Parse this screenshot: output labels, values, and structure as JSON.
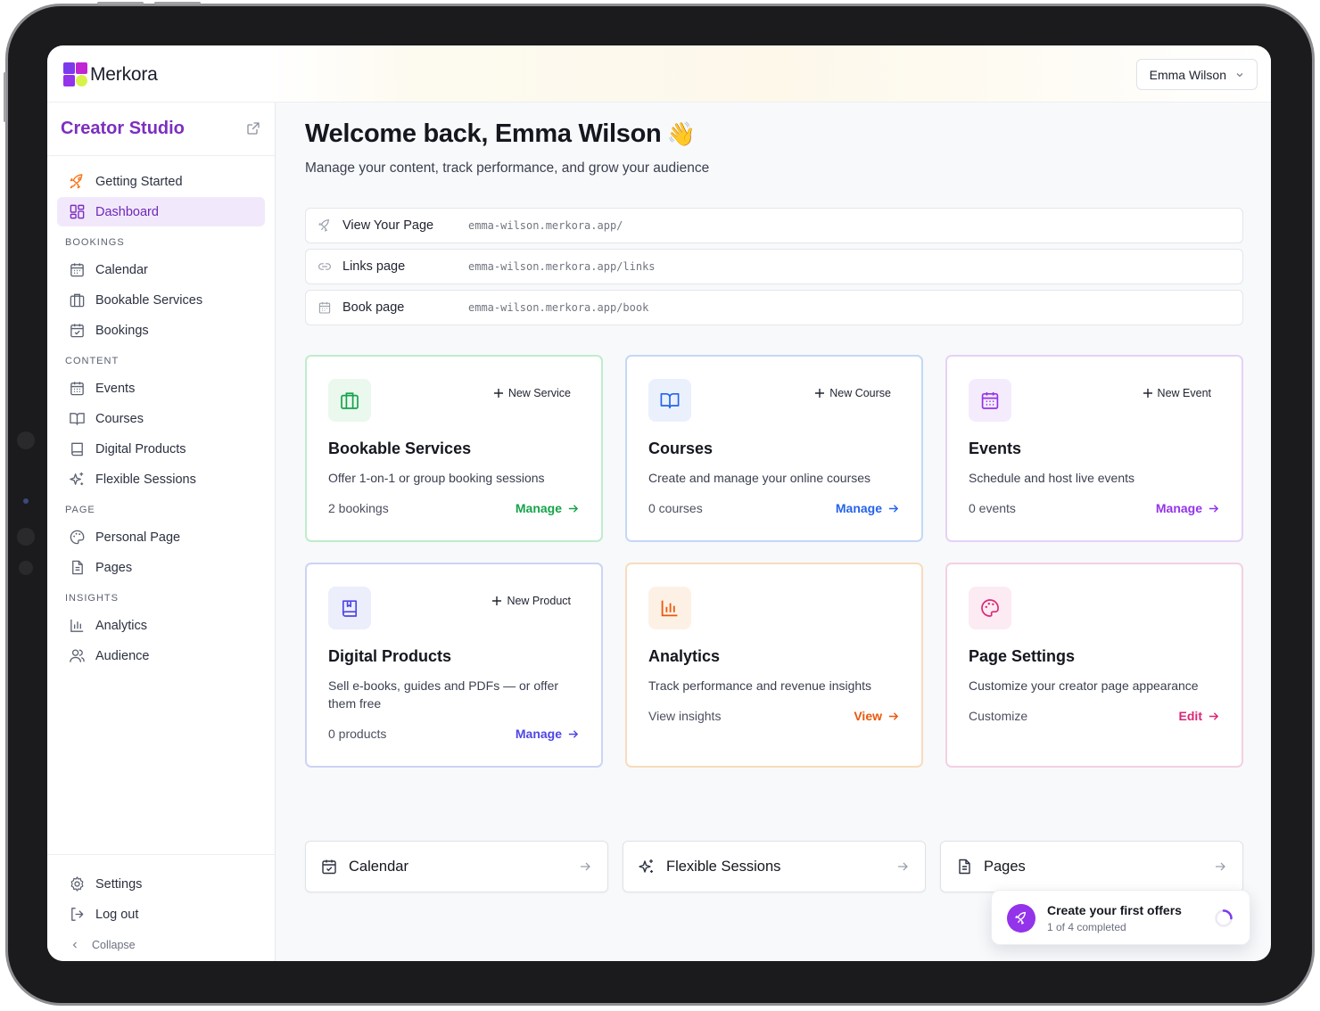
{
  "app": {
    "brand": "Merkora",
    "user_name": "Emma Wilson"
  },
  "sidebar": {
    "title": "Creator Studio",
    "top_items": [
      {
        "label": "Getting Started",
        "icon": "rocket-icon"
      },
      {
        "label": "Dashboard",
        "icon": "dashboard-icon",
        "active": true
      }
    ],
    "sections": [
      {
        "title": "BOOKINGS",
        "items": [
          {
            "label": "Calendar",
            "icon": "calendar-icon"
          },
          {
            "label": "Bookable Services",
            "icon": "briefcase-icon"
          },
          {
            "label": "Bookings",
            "icon": "calendar-check-icon"
          }
        ]
      },
      {
        "title": "CONTENT",
        "items": [
          {
            "label": "Events",
            "icon": "calendar-grid-icon"
          },
          {
            "label": "Courses",
            "icon": "book-open-icon"
          },
          {
            "label": "Digital Products",
            "icon": "book-icon"
          },
          {
            "label": "Flexible Sessions",
            "icon": "sparkles-icon"
          }
        ]
      },
      {
        "title": "PAGE",
        "items": [
          {
            "label": "Personal Page",
            "icon": "palette-icon"
          },
          {
            "label": "Pages",
            "icon": "file-text-icon"
          }
        ]
      },
      {
        "title": "INSIGHTS",
        "items": [
          {
            "label": "Analytics",
            "icon": "bar-chart-icon"
          },
          {
            "label": "Audience",
            "icon": "users-icon"
          }
        ]
      }
    ],
    "bottom": {
      "settings": "Settings",
      "logout": "Log out",
      "collapse": "Collapse"
    }
  },
  "main": {
    "welcome": "Welcome back, Emma Wilson",
    "wave_emoji": "👋",
    "subtitle": "Manage your content, track performance, and grow your audience",
    "links": [
      {
        "label": "View Your Page",
        "url": "emma-wilson.merkora.app/",
        "icon": "rocket-icon"
      },
      {
        "label": "Links page",
        "url": "emma-wilson.merkora.app/links",
        "icon": "link-icon"
      },
      {
        "label": "Book page",
        "url": "emma-wilson.merkora.app/book",
        "icon": "calendar-icon"
      }
    ],
    "cards": [
      {
        "title": "Bookable Services",
        "new_label": "New Service",
        "desc": "Offer 1-on-1 or group booking sessions",
        "count": "2 bookings",
        "action": "Manage",
        "color": "#16a34a",
        "border": "#bfeccc",
        "tint": "#eaf8ee",
        "icon": "briefcase-icon"
      },
      {
        "title": "Courses",
        "new_label": "New Course",
        "desc": "Create and manage your online courses",
        "count": "0 courses",
        "action": "Manage",
        "color": "#2563eb",
        "border": "#c4d8f7",
        "tint": "#eaf1fd",
        "icon": "book-open-icon"
      },
      {
        "title": "Events",
        "new_label": "New Event",
        "desc": "Schedule and host live events",
        "count": "0 events",
        "action": "Manage",
        "color": "#9333ea",
        "border": "#e6d2f7",
        "tint": "#f4ebfc",
        "icon": "calendar-grid-icon"
      },
      {
        "title": "Digital Products",
        "new_label": "New Product",
        "desc": "Sell e-books, guides and PDFs — or offer them free",
        "count": "0 products",
        "action": "Manage",
        "color": "#4f46e5",
        "border": "#cdd3f4",
        "tint": "#eceefc",
        "icon": "book-icon"
      },
      {
        "title": "Analytics",
        "new_label": "",
        "desc": "Track performance and revenue insights",
        "count": "View insights",
        "action": "View",
        "color": "#ea580c",
        "border": "#f8dcbc",
        "tint": "#fdf1e6",
        "icon": "bar-chart-icon"
      },
      {
        "title": "Page Settings",
        "new_label": "",
        "desc": "Customize your creator page appearance",
        "count": "Customize",
        "action": "Edit",
        "color": "#db2777",
        "border": "#f4d0e2",
        "tint": "#fcebf3",
        "icon": "palette-icon"
      }
    ],
    "quick_links": [
      {
        "label": "Calendar",
        "icon": "calendar-check-icon"
      },
      {
        "label": "Flexible Sessions",
        "icon": "sparkles-icon"
      },
      {
        "label": "Pages",
        "icon": "file-text-icon"
      }
    ]
  },
  "toast": {
    "title": "Create your first offers",
    "subtitle": "1 of 4 completed",
    "progress": 0.25
  }
}
